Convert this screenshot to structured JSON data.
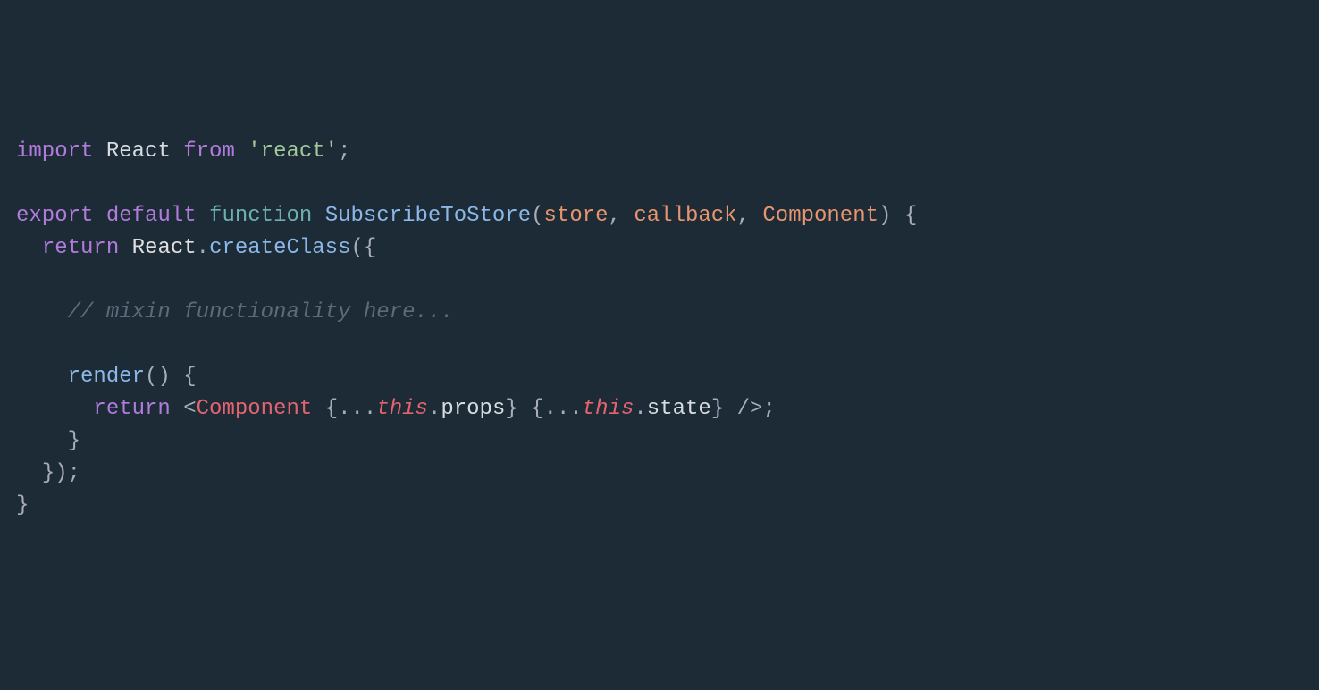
{
  "code": {
    "line1": {
      "import": "import",
      "react": "React",
      "from": "from",
      "string": "'react'",
      "semi": ";"
    },
    "line3": {
      "export": "export",
      "default": "default",
      "function": "function",
      "name": "SubscribeToStore",
      "lparen": "(",
      "p1": "store",
      "c1": ",",
      "p2": "callback",
      "c2": ",",
      "p3": "Component",
      "rparen": ")",
      "lbrace": "{"
    },
    "line4": {
      "return": "return",
      "react": "React",
      "dot": ".",
      "create": "createClass",
      "lparen": "(",
      "lbrace": "{"
    },
    "line6": {
      "comment": "// mixin functionality here..."
    },
    "line8": {
      "render": "render",
      "parens": "()",
      "lbrace": "{"
    },
    "line9": {
      "return": "return",
      "lt": "<",
      "comp": "Component",
      "lb1": "{",
      "spread1": "...",
      "this1": "this",
      "dot1": ".",
      "props": "props",
      "rb1": "}",
      "lb2": "{",
      "spread2": "...",
      "this2": "this",
      "dot2": ".",
      "state": "state",
      "rb2": "}",
      "close": "/>",
      "semi": ";"
    },
    "line10": {
      "rbrace": "}"
    },
    "line11": {
      "rbrace": "});"
    },
    "line12": {
      "rbrace": "}"
    }
  }
}
